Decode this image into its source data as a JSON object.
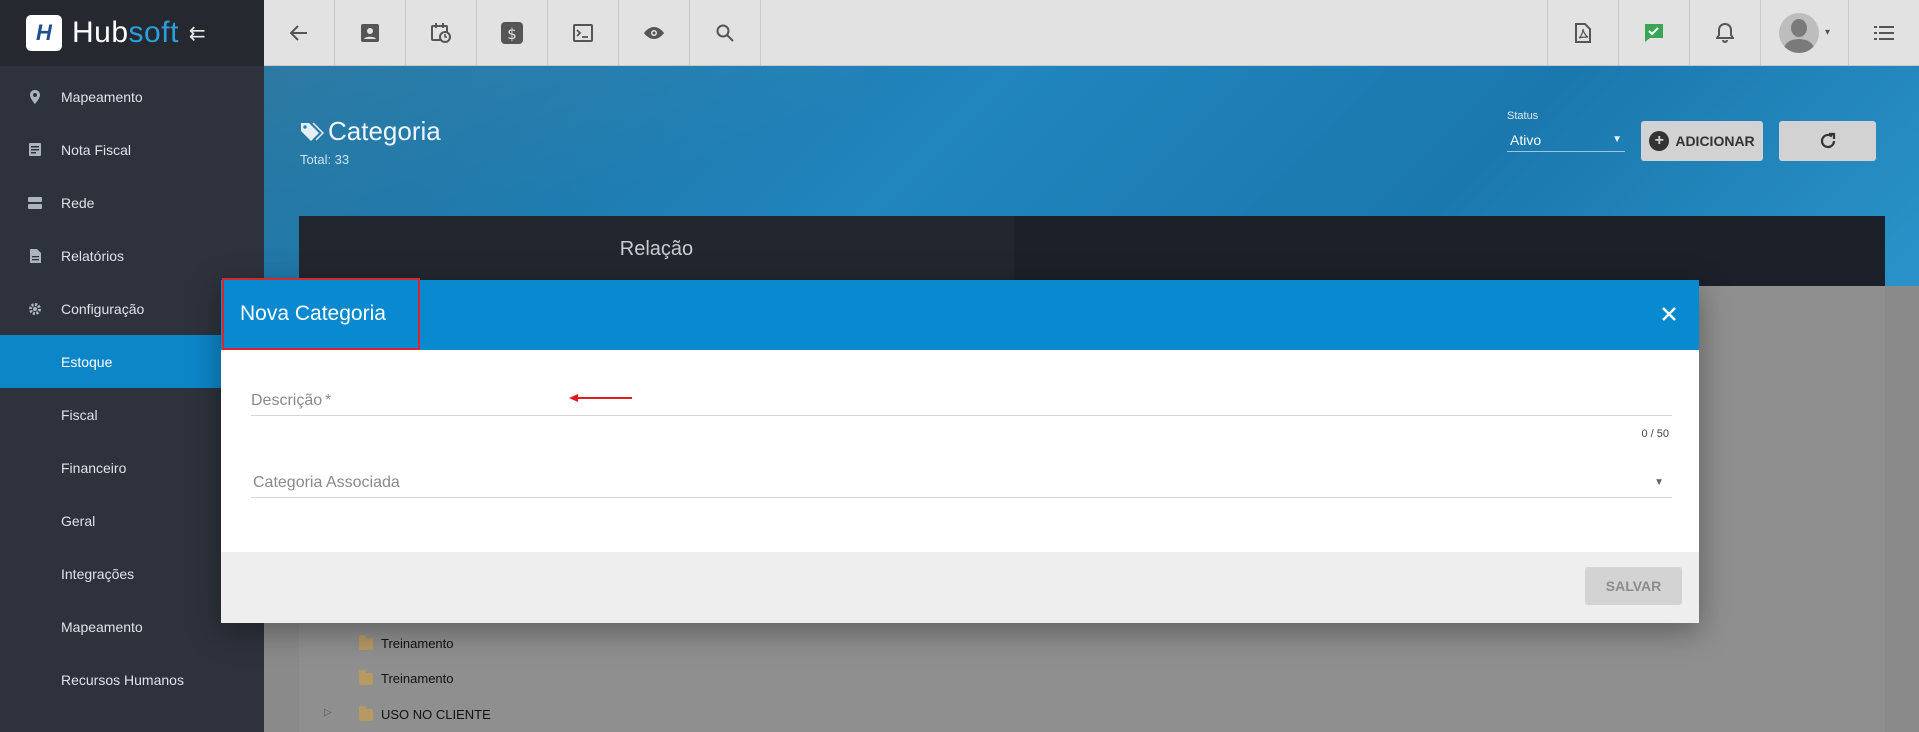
{
  "brand": {
    "logo_letter": "H",
    "name_part1": "Hub",
    "name_part2": "soft"
  },
  "sidebar": {
    "items": [
      {
        "label": "Mapeamento",
        "icon": "map-pin-icon"
      },
      {
        "label": "Nota Fiscal",
        "icon": "receipt-icon"
      },
      {
        "label": "Rede",
        "icon": "server-icon"
      },
      {
        "label": "Relatórios",
        "icon": "report-icon"
      },
      {
        "label": "Configuração",
        "icon": "gear-icon"
      },
      {
        "label": "Estoque",
        "active": true
      },
      {
        "label": "Fiscal"
      },
      {
        "label": "Financeiro"
      },
      {
        "label": "Geral"
      },
      {
        "label": "Integrações"
      },
      {
        "label": "Mapeamento"
      },
      {
        "label": "Recursos Humanos"
      }
    ]
  },
  "topbar": {
    "left_icons": [
      "back-arrow-icon",
      "contact-card-icon",
      "calendar-clock-icon",
      "dollar-icon",
      "terminal-icon",
      "eye-icon",
      "search-icon"
    ],
    "right_icons": [
      "pdf-icon",
      "chat-check-icon",
      "bell-icon",
      "avatar",
      "list-icon"
    ]
  },
  "page": {
    "title": "Categoria",
    "total": "Total: 33",
    "status_label": "Status",
    "status_value": "Ativo",
    "add_label": "ADICIONAR",
    "tab_label": "Relação"
  },
  "tree": [
    {
      "label": "Treinamento"
    },
    {
      "label": "Treinamento"
    },
    {
      "label": "USO NO CLIENTE"
    }
  ],
  "modal": {
    "title": "Nova Categoria",
    "description_label": "Descrição",
    "required_mark": "*",
    "counter": "0 / 50",
    "category_label": "Categoria Associada",
    "save_label": "SALVAR"
  },
  "colors": {
    "accent": "#0889d0",
    "sidebar": "#2d323c",
    "highlight": "#d9262a"
  }
}
